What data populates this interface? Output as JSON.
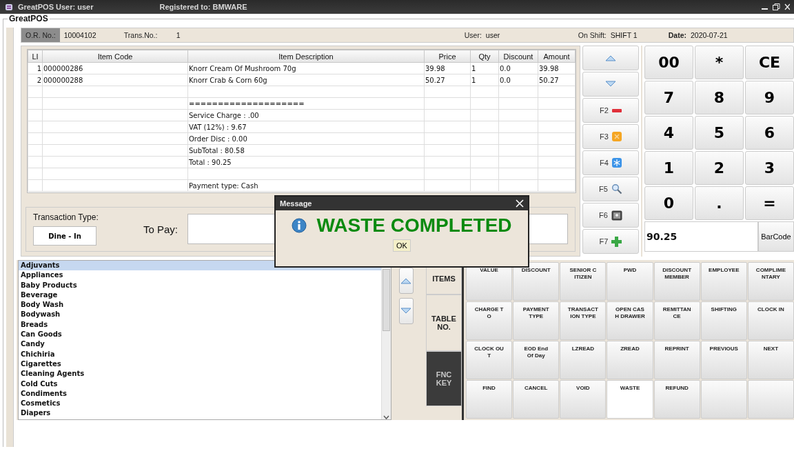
{
  "window": {
    "title": "GreatPOS  User: user",
    "registered": "Registered to:  BMWARE"
  },
  "group_title": "GreatPOS",
  "header": {
    "or_label": "O.R. No.:",
    "or_value": "10004102",
    "trans_label": "Trans.No.:",
    "trans_value": "1",
    "user_label": "User:",
    "user_value": "user",
    "shift_label": "On Shift:",
    "shift_value": "SHIFT 1",
    "date_label": "Date:",
    "date_value": "2020-07-21"
  },
  "table": {
    "columns": [
      "LI",
      "Item Code",
      "Item Description",
      "Price",
      "Qty",
      "Discount",
      "Amount"
    ],
    "rows": [
      {
        "li": "1",
        "code": "000000286",
        "description": "Knorr Cream Of Mushroom 70g",
        "price": "39.98",
        "qty": "1",
        "discount": "0.0",
        "amount": "39.98"
      },
      {
        "li": "2",
        "code": "000000288",
        "description": "Knorr Crab & Corn 60g",
        "price": "50.27",
        "qty": "1",
        "discount": "0.0",
        "amount": "50.27"
      },
      {},
      {
        "description": "===================="
      },
      {
        "description": "Service Charge : .00"
      },
      {
        "description": "VAT (12%) : 9.67"
      },
      {
        "description": "Order Disc : 0.00"
      },
      {
        "description": "SubTotal : 80.58"
      },
      {
        "description": "Total : 90.25"
      },
      {},
      {
        "description": "Payment type: Cash"
      }
    ]
  },
  "transaction": {
    "type_label": "Transaction Type:",
    "type_button": "Dine - In",
    "to_pay_label": "To Pay:"
  },
  "function_keys": [
    {
      "kind": "up"
    },
    {
      "kind": "down"
    },
    {
      "kind": "remove",
      "label": "F2"
    },
    {
      "kind": "cancel",
      "label": "F3"
    },
    {
      "kind": "snow",
      "label": "F4"
    },
    {
      "kind": "search",
      "label": "F5"
    },
    {
      "kind": "picture",
      "label": "F6"
    },
    {
      "kind": "add",
      "label": "F7"
    }
  ],
  "keypad": {
    "keys": [
      "00",
      "*",
      "CE",
      "7",
      "8",
      "9",
      "4",
      "5",
      "6",
      "1",
      "2",
      "3",
      "0",
      ".",
      "="
    ],
    "display": "90.25",
    "barcode_button": "BarCode"
  },
  "categories": [
    {
      "label": "Adjuvants",
      "selected": true
    },
    {
      "label": "Appliances",
      "selected": false
    },
    {
      "label": "Baby Products",
      "selected": false
    },
    {
      "label": "Beverage",
      "selected": false
    },
    {
      "label": "Body Wash",
      "selected": false
    },
    {
      "label": "Bodywash",
      "selected": false
    },
    {
      "label": "Breads",
      "selected": false
    },
    {
      "label": "Can Goods",
      "selected": false
    },
    {
      "label": "Candy",
      "selected": false
    },
    {
      "label": "Chichiria",
      "selected": false
    },
    {
      "label": "Cigarettes",
      "selected": false
    },
    {
      "label": "Cleaning Agents",
      "selected": false
    },
    {
      "label": "Cold Cuts",
      "selected": false
    },
    {
      "label": "Condiments",
      "selected": false
    },
    {
      "label": "Cosmetics",
      "selected": false
    },
    {
      "label": "Diapers",
      "selected": false
    }
  ],
  "tabs": [
    {
      "label": "ITEMS",
      "selected": false
    },
    {
      "label": "TABLE\nNO.",
      "selected": false
    },
    {
      "label": "FNC\nKEY",
      "selected": true
    }
  ],
  "actions": [
    {
      "label": "VALUE",
      "selected": false
    },
    {
      "label": "DISCOUNT",
      "selected": false
    },
    {
      "label": "SENIOR C\nITIZEN",
      "selected": false
    },
    {
      "label": "PWD",
      "selected": false
    },
    {
      "label": "DISCOUNT\nMEMBER",
      "selected": false
    },
    {
      "label": "EMPLOYEE",
      "selected": false
    },
    {
      "label": "COMPLIME\nNTARY",
      "selected": false
    },
    {
      "label": "CHARGE T\nO",
      "selected": false
    },
    {
      "label": "PAYMENT\nTYPE",
      "selected": false
    },
    {
      "label": "TRANSACT\nION TYPE",
      "selected": false
    },
    {
      "label": "OPEN CAS\nH DRAWER",
      "selected": false
    },
    {
      "label": "REMITTAN\nCE",
      "selected": false
    },
    {
      "label": "SHIFTING",
      "selected": false
    },
    {
      "label": "CLOCK IN",
      "selected": false
    },
    {
      "label": "CLOCK OU\nT",
      "selected": false
    },
    {
      "label": "EOD End\nOf Day",
      "selected": false
    },
    {
      "label": "LZREAD",
      "selected": false
    },
    {
      "label": "ZREAD",
      "selected": false
    },
    {
      "label": "REPRINT",
      "selected": false
    },
    {
      "label": "PREVIOUS",
      "selected": false
    },
    {
      "label": "NEXT",
      "selected": false
    },
    {
      "label": "FIND",
      "selected": false
    },
    {
      "label": "CANCEL",
      "selected": false
    },
    {
      "label": "VOID",
      "selected": false
    },
    {
      "label": "WASTE",
      "selected": true
    },
    {
      "label": "REFUND",
      "selected": false
    }
  ],
  "dialog": {
    "title": "Message",
    "message": "WASTE COMPLETED",
    "ok": "OK"
  }
}
